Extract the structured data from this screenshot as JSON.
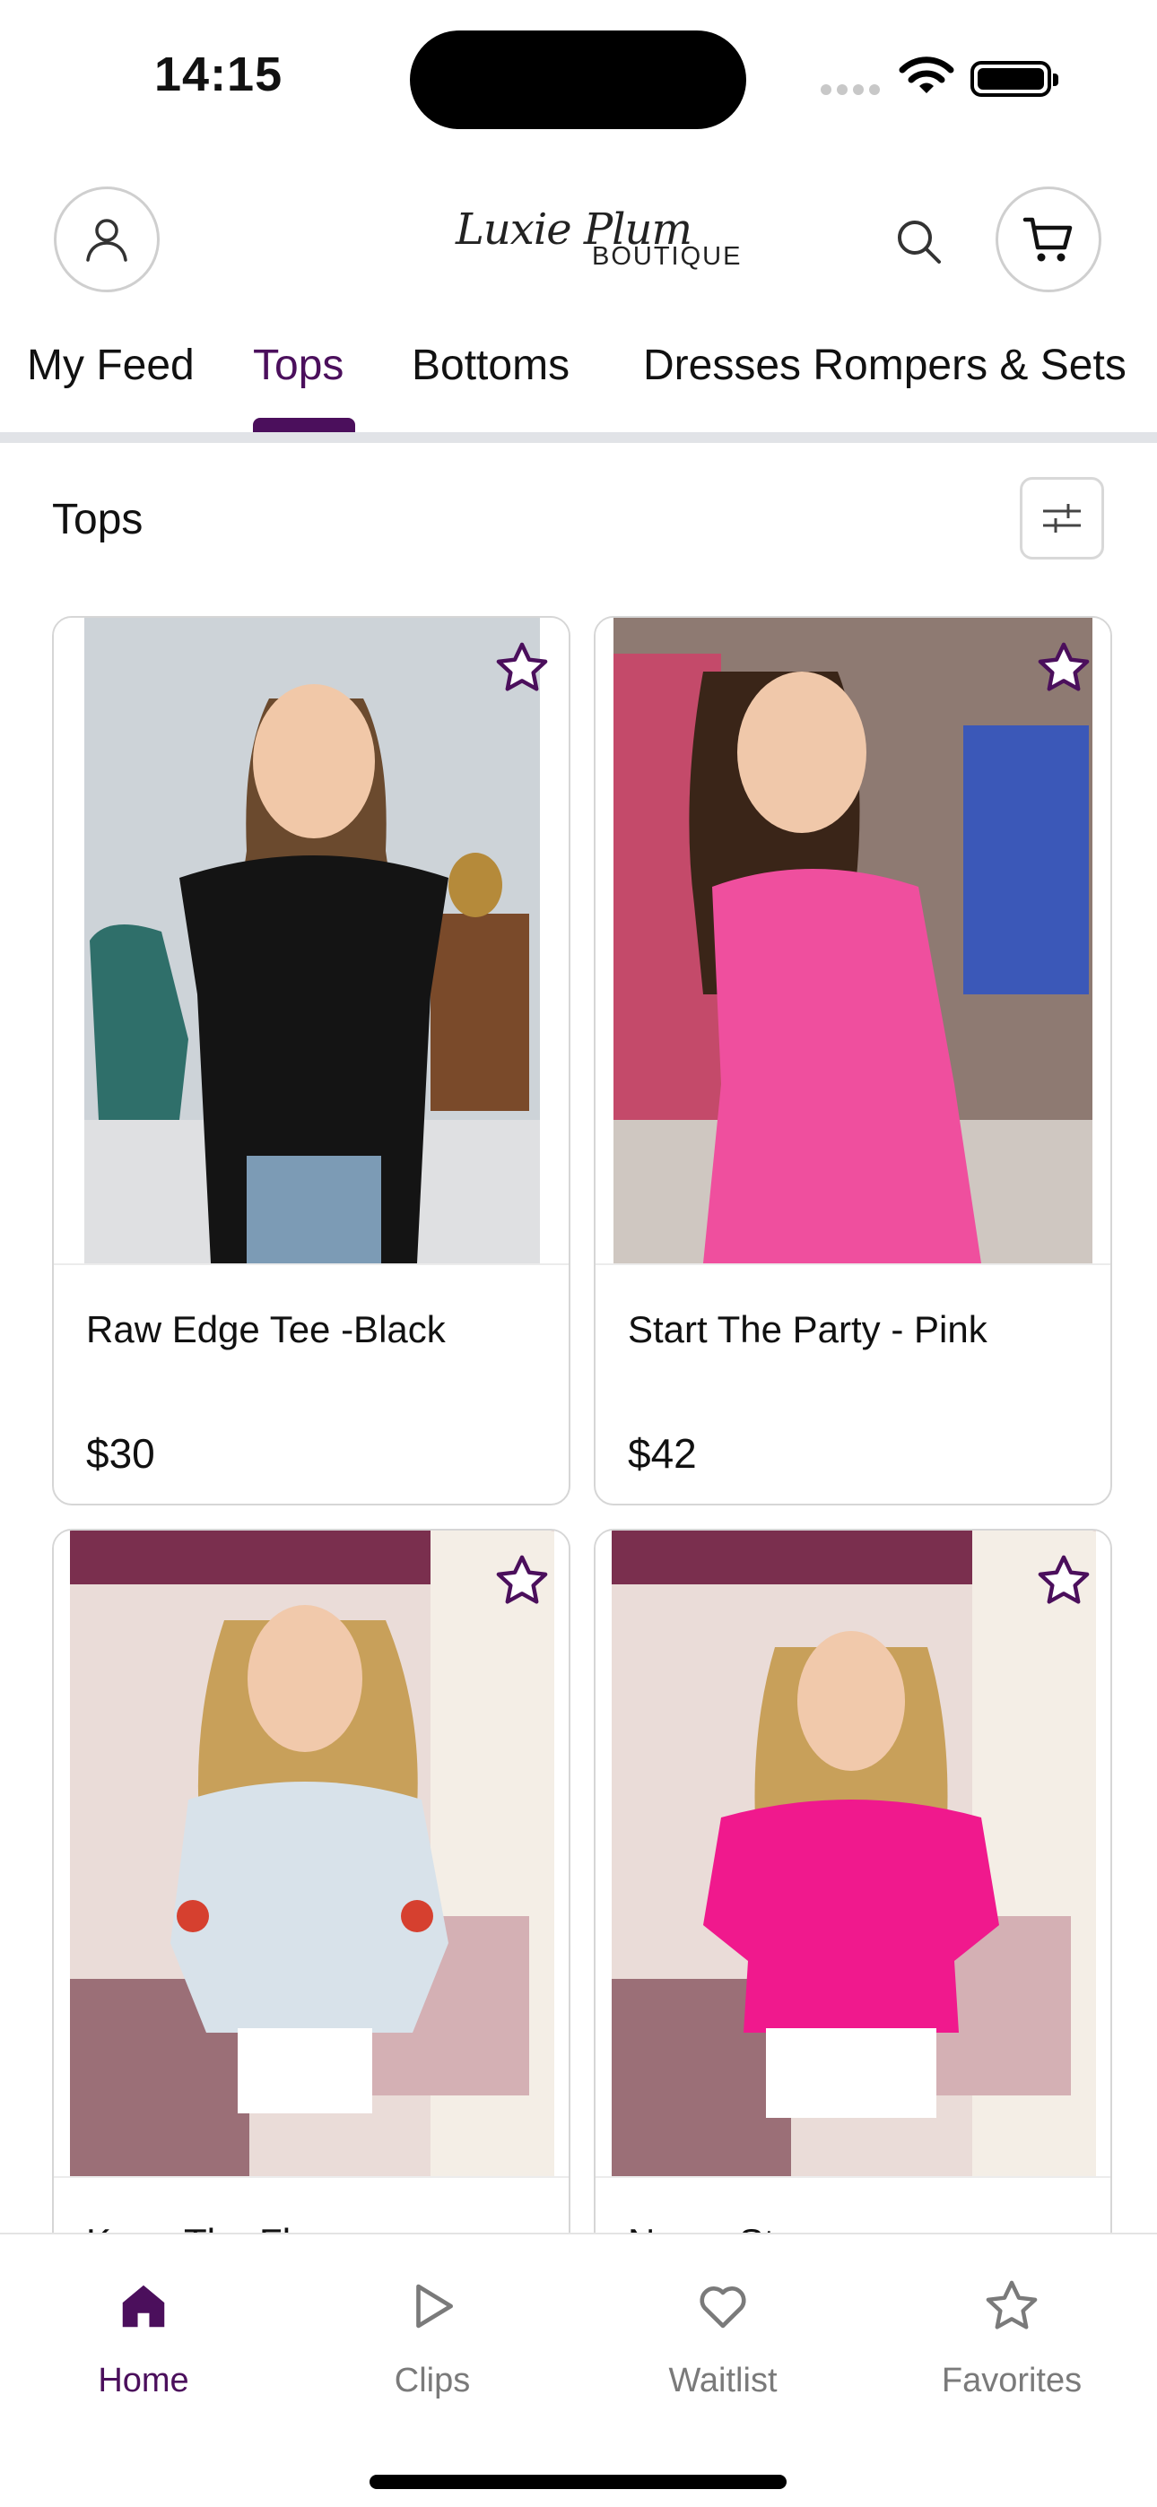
{
  "status_bar": {
    "time": "14:15"
  },
  "header": {
    "logo_script": "Luxie Plum",
    "logo_sub": "BOUTIQUE"
  },
  "tabs": [
    {
      "label": "My Feed",
      "active": false
    },
    {
      "label": "Tops",
      "active": true
    },
    {
      "label": "Bottoms",
      "active": false
    },
    {
      "label": "Dresses Rompers & Sets",
      "active": false
    }
  ],
  "section": {
    "title": "Tops"
  },
  "products": [
    {
      "name": "Raw Edge Tee -Black",
      "price": "$30"
    },
    {
      "name": "Start The Party - Pink",
      "price": "$42"
    },
    {
      "name": "Keep The Flowers",
      "price": ""
    },
    {
      "name": "Never Stop",
      "price": ""
    }
  ],
  "bottom_nav": [
    {
      "label": "Home",
      "icon": "home-icon",
      "active": true
    },
    {
      "label": "Clips",
      "icon": "play-icon",
      "active": false
    },
    {
      "label": "Waitlist",
      "icon": "heart-icon",
      "active": false
    },
    {
      "label": "Favorites",
      "icon": "star-icon",
      "active": false
    }
  ],
  "colors": {
    "accent": "#4b0f5c",
    "inactive": "#7a7a7a",
    "black_tee": "#111111",
    "pink_top": "#ef4f9e",
    "hot_pink_top": "#f0198d",
    "striped_top": "#d8e2ea"
  }
}
